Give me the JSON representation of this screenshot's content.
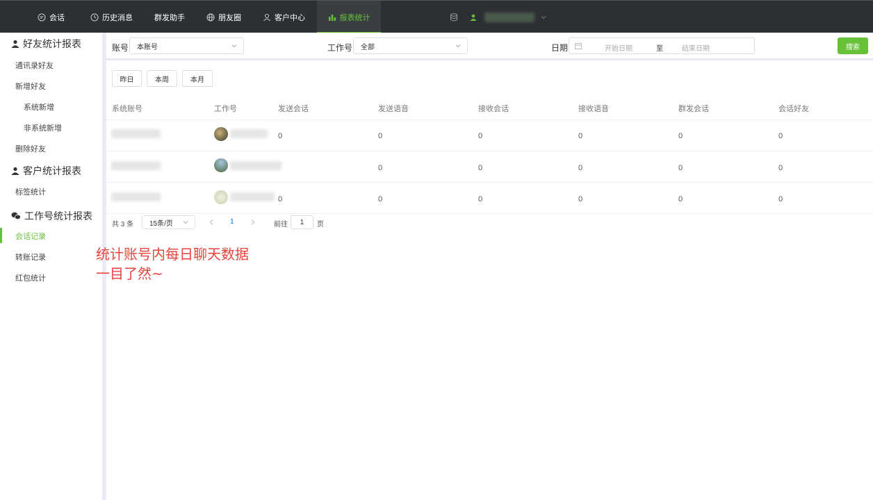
{
  "nav": {
    "items": [
      {
        "label": "会话",
        "icon": "chat-icon"
      },
      {
        "label": "历史消息",
        "icon": "clock-icon"
      },
      {
        "label": "群发助手",
        "icon": ""
      },
      {
        "label": "朋友圈",
        "icon": "globe-icon"
      },
      {
        "label": "客户中心",
        "icon": "user-icon"
      },
      {
        "label": "报表统计",
        "icon": "bar-chart-icon",
        "active": true
      }
    ]
  },
  "sidebar": {
    "groups": [
      {
        "title": "好友统计报表",
        "icon": "user-icon",
        "items": [
          "通讯录好友",
          "新增好友",
          "系统新增",
          "非系统新增",
          "删除好友"
        ]
      },
      {
        "title": "客户统计报表",
        "icon": "user-icon",
        "items": [
          "标签统计"
        ]
      },
      {
        "title": "工作号统计报表",
        "icon": "wechat-icon",
        "items": [
          "会话记录",
          "转账记录",
          "红包统计"
        ]
      }
    ],
    "active_item": "会话记录"
  },
  "filters": {
    "account_label": "账号",
    "account_value": "本账号",
    "workno_label": "工作号",
    "workno_value": "全部",
    "date_label": "日期",
    "date_start_placeholder": "开始日期",
    "date_sep": "至",
    "date_end_placeholder": "结束日期",
    "search_label": "搜索"
  },
  "quick": {
    "yesterday": "昨日",
    "week": "本周",
    "month": "本月"
  },
  "table": {
    "headers": [
      "系统账号",
      "工作号",
      "发送会话",
      "发送语音",
      "接收会话",
      "接收语音",
      "群发会话",
      "会话好友"
    ],
    "rows": [
      {
        "send_session": "0",
        "send_voice": "0",
        "recv_session": "0",
        "recv_voice": "0",
        "group_session": "0",
        "session_friends": "0"
      },
      {
        "send_session": "",
        "send_voice": "0",
        "recv_session": "0",
        "recv_voice": "0",
        "group_session": "0",
        "session_friends": "0"
      },
      {
        "send_session": "0",
        "send_voice": "0",
        "recv_session": "0",
        "recv_voice": "0",
        "group_session": "0",
        "session_friends": "0"
      }
    ]
  },
  "pager": {
    "total": "共 3 条",
    "page_size": "15条/页",
    "current": "1",
    "goto_label": "前往",
    "goto_value": "1",
    "page_suffix": "页"
  },
  "annotation": {
    "line1": "统计账号内每日聊天数据",
    "line2": "一目了然~"
  },
  "colors": {
    "accent": "#67c23a",
    "topbar": "#2c2f33",
    "annotation": "#e8433d"
  }
}
